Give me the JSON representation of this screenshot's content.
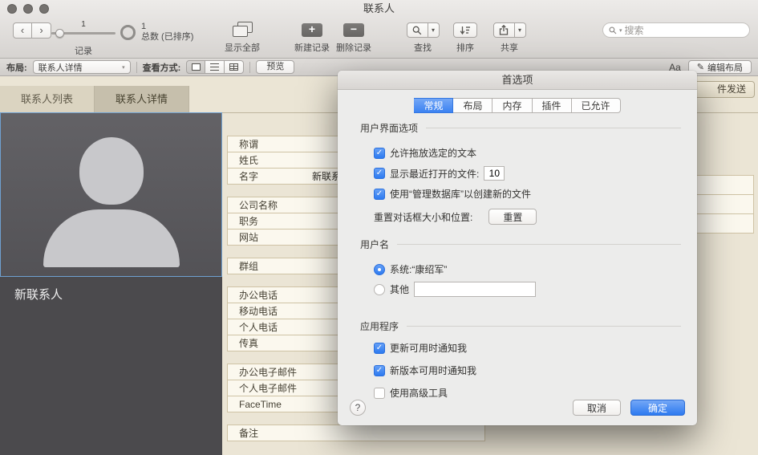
{
  "titlebar": {
    "title": "联系人"
  },
  "toolbar": {
    "record_number": "1",
    "records_label": "记录",
    "total_count": "1",
    "total_label": "总数 (已排序)",
    "show_all_label": "显示全部",
    "new_record_label": "新建记录",
    "delete_record_label": "删除记录",
    "find_label": "查找",
    "sort_label": "排序",
    "share_label": "共享",
    "search_placeholder": "搜索"
  },
  "layoutbar": {
    "layout_label": "布局:",
    "layout_value": "联系人详情",
    "view_label": "查看方式:",
    "preview_label": "预览",
    "text_format_icon": "Aa",
    "edit_layout_label": "编辑布局"
  },
  "tabs": [
    {
      "label": "联系人列表"
    },
    {
      "label": "联系人详情",
      "active": true
    }
  ],
  "content": {
    "send_card_label": "件发送",
    "contact_name": "新联系人",
    "fields": [
      {
        "label": "称谓"
      },
      {
        "label": "姓氏"
      },
      {
        "label": "名字",
        "value": "新联系人"
      },
      {
        "label": "公司名称",
        "gap": true
      },
      {
        "label": "职务"
      },
      {
        "label": "网站"
      },
      {
        "label": "群组",
        "gap": true
      },
      {
        "label": "办公电话",
        "gap": true
      },
      {
        "label": "移动电话"
      },
      {
        "label": "个人电话"
      },
      {
        "label": "传真"
      },
      {
        "label": "办公电子邮件",
        "gap": true
      },
      {
        "label": "个人电子邮件"
      },
      {
        "label": "FaceTime"
      },
      {
        "label": "备注",
        "gap": true
      }
    ]
  },
  "dialog": {
    "title": "首选项",
    "tabs": [
      {
        "label": "常规",
        "selected": true
      },
      {
        "label": "布局"
      },
      {
        "label": "内存"
      },
      {
        "label": "插件"
      },
      {
        "label": "已允许"
      }
    ],
    "ui_section": {
      "heading": "用户界面选项",
      "drag_checkbox": {
        "label": "允许拖放选定的文本",
        "checked": true
      },
      "recent_checkbox": {
        "label": "显示最近打开的文件:",
        "checked": true,
        "value": "10"
      },
      "managedb_checkbox": {
        "label": "使用“管理数据库”以创建新的文件",
        "checked": true
      },
      "reset_label": "重置对话框大小和位置:",
      "reset_button": "重置"
    },
    "user_section": {
      "heading": "用户名",
      "system_radio": {
        "label": "系统:“康绍军”",
        "selected": true
      },
      "other_radio": {
        "label": "其他",
        "selected": false,
        "value": ""
      }
    },
    "app_section": {
      "heading": "应用程序",
      "update_checkbox": {
        "label": "更新可用时通知我",
        "checked": true
      },
      "newversion_checkbox": {
        "label": "新版本可用时通知我",
        "checked": true
      },
      "advanced_checkbox": {
        "label": "使用高级工具",
        "checked": false
      }
    },
    "help_button": "?",
    "cancel_button": "取消",
    "ok_button": "确定"
  },
  "icons": {
    "back": "‹",
    "forward": "›",
    "dropdown": "▾",
    "pencil": "✎",
    "plus": "+",
    "minus": "−",
    "check": "✓"
  },
  "colors": {
    "accent_blue": "#2d7af0",
    "selection_border": "#6fa0d0",
    "dark_panel": "#4b4a4d",
    "content_beige": "#ebe5d5"
  }
}
